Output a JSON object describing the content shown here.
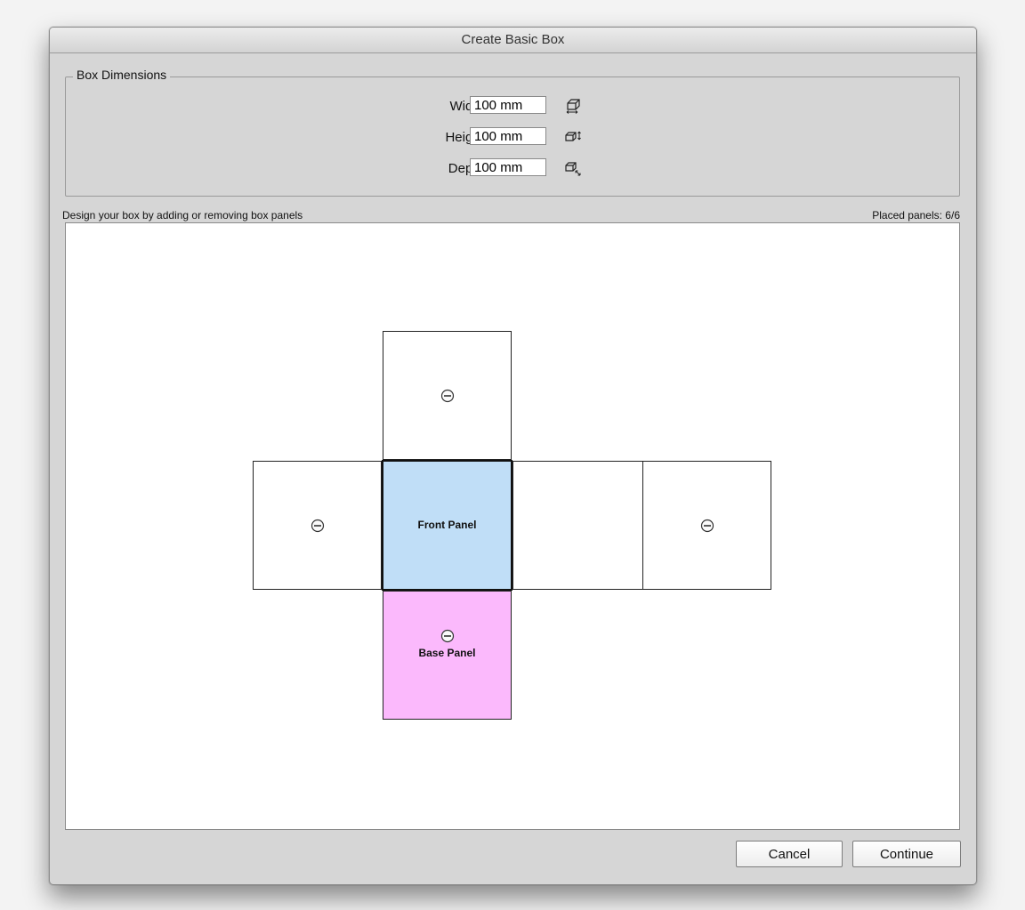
{
  "dialog": {
    "title": "Create Basic Box"
  },
  "dimensions": {
    "legend": "Box Dimensions",
    "width": {
      "label": "Width:",
      "value": "100 mm",
      "icon": "box-width-icon"
    },
    "height": {
      "label": "Height:",
      "value": "100 mm",
      "icon": "box-height-icon"
    },
    "depth": {
      "label": "Depth:",
      "value": "100 mm",
      "icon": "box-depth-icon"
    }
  },
  "design": {
    "instruction": "Design your box by adding or removing box panels",
    "placed_panels": "Placed panels: 6/6"
  },
  "panels": {
    "front": {
      "label": "Front Panel",
      "color": "#c0def7"
    },
    "base": {
      "label": "Base Panel",
      "color": "#fbb9fc"
    }
  },
  "buttons": {
    "cancel": "Cancel",
    "continue": "Continue"
  }
}
